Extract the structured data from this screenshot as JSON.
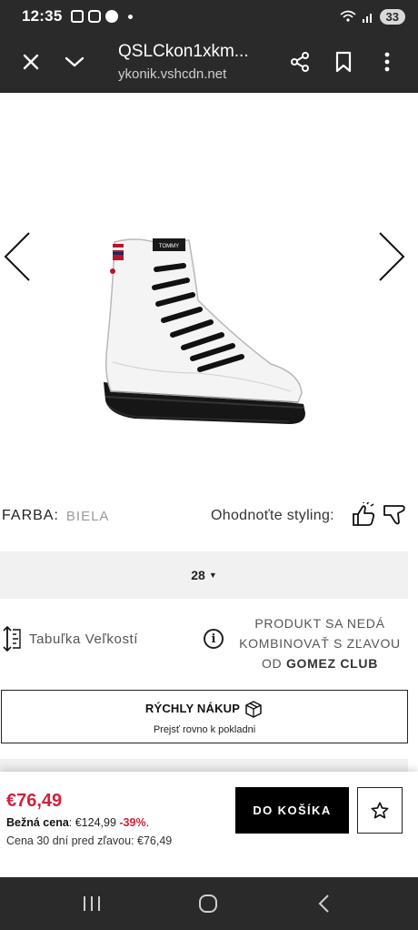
{
  "status_bar": {
    "time": "12:35",
    "battery": "33"
  },
  "browser": {
    "title": "QSLCkon1xkm...",
    "url": "ykonik.vshcdn.net",
    "icons": [
      "close-icon",
      "chevron-down-icon",
      "share-icon",
      "bookmark-icon",
      "more-vert-icon"
    ]
  },
  "product": {
    "image_label": "TOMMY",
    "color_label": "FARBA:",
    "color_value": "BIELA",
    "rate_label": "Ohodnoťte styling:",
    "size_value": "28",
    "size_table_label": "Tabuľka Veľkostí",
    "promo_line1": "PRODUKT SA NEDÁ",
    "promo_line2": "KOMBINOVAŤ S ZĽAVOU",
    "promo_line3_prefix": "OD ",
    "promo_line3_bold": "GOMEZ CLUB",
    "quick_buy_title": "RÝCHLY NÁKUP",
    "quick_buy_sub": "Prejsť rovno k pokladni"
  },
  "pricing": {
    "price": "€76,49",
    "regular_label": "Bežná cena",
    "regular_value": ": €124,99 ",
    "discount": "-39%",
    "regular_suffix": ".",
    "price_30": "Cena 30 dní pred zľavou: €76,49",
    "add_to_cart": "DO KOŠÍKA"
  },
  "colors": {
    "accent_red": "#d0213a",
    "dark_bar": "#2a2a2a"
  }
}
